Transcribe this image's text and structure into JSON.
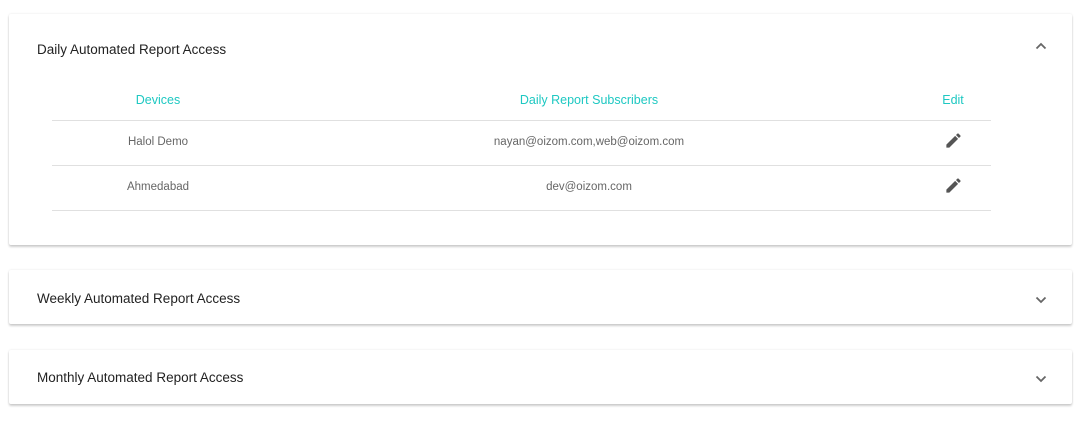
{
  "panels": {
    "daily": {
      "title": "Daily Automated Report Access",
      "expanded": true,
      "table": {
        "headers": {
          "devices": "Devices",
          "subscribers": "Daily Report Subscribers",
          "edit": "Edit"
        },
        "rows": [
          {
            "device": "Halol Demo",
            "subscribers": "nayan@oizom.com,web@oizom.com",
            "edit_icon": "pencil-icon"
          },
          {
            "device": "Ahmedabad",
            "subscribers": "dev@oizom.com",
            "edit_icon": "pencil-icon"
          }
        ]
      },
      "toggle_icon": "chevron-up-icon"
    },
    "weekly": {
      "title": "Weekly Automated Report Access",
      "expanded": false,
      "toggle_icon": "chevron-down-icon"
    },
    "monthly": {
      "title": "Monthly Automated Report Access",
      "expanded": false,
      "toggle_icon": "chevron-down-icon"
    }
  },
  "colors": {
    "accent": "#1ec8c2",
    "title_text": "#222222",
    "cell_text": "#666666",
    "icon": "#555555",
    "divider": "#e0e0e0"
  }
}
